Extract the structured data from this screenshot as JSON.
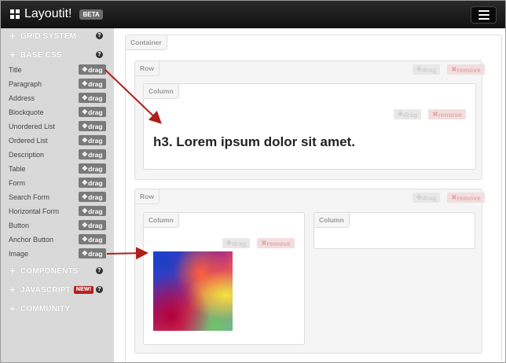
{
  "app": {
    "title": "Layoutit!",
    "beta": "BETA"
  },
  "sidebar": {
    "sections": [
      {
        "label": "GRID SYSTEM",
        "help": "?"
      },
      {
        "label": "BASE CSS",
        "help": "?"
      },
      {
        "label": "COMPONENTS",
        "help": "?"
      },
      {
        "label": "JAVASCRIPT",
        "badge": "NEW!",
        "help": "?"
      },
      {
        "label": "COMMUNITY"
      }
    ],
    "drag_label": "drag",
    "items": [
      "Title",
      "Paragraph",
      "Address",
      "Blockquote",
      "Unordered List",
      "Ordered List",
      "Description",
      "Table",
      "Form",
      "Search Form",
      "Horizontal Form",
      "Button",
      "Anchor Button",
      "Image"
    ]
  },
  "canvas": {
    "container_label": "Container",
    "row_label": "Row",
    "column_label": "Column",
    "drag_label": "drag",
    "remove_label": "remove",
    "heading_text": "h3. Lorem ipsum dolor sit amet."
  },
  "colors": {
    "navbar": "#111111",
    "sidebar": "#d9d9d9",
    "arrow": "#b01d1d",
    "remove": "#f2dede"
  }
}
